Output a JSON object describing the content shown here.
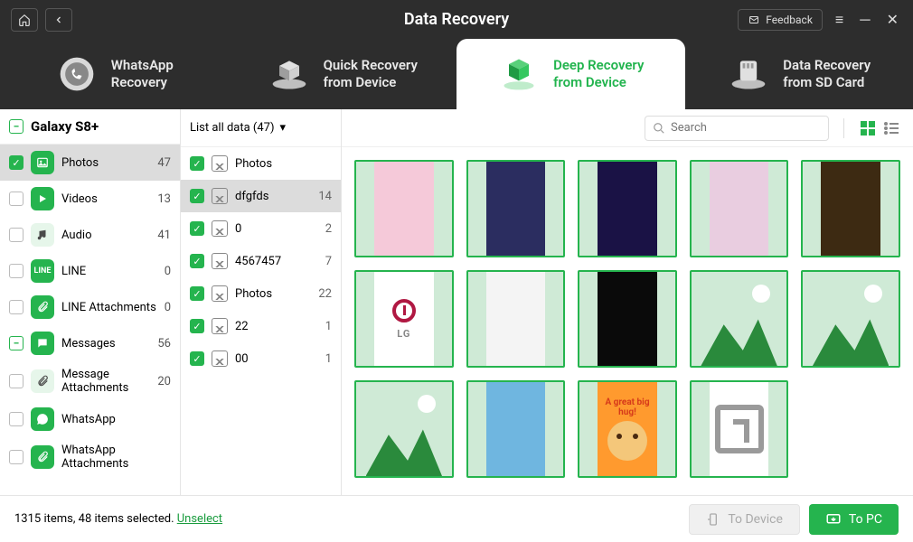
{
  "window": {
    "title": "Data Recovery",
    "feedback_label": "Feedback"
  },
  "tabs": [
    {
      "line1": "WhatsApp",
      "line2": "Recovery"
    },
    {
      "line1": "Quick Recovery",
      "line2": "from Device"
    },
    {
      "line1": "Deep Recovery",
      "line2": "from Device"
    },
    {
      "line1": "Data Recovery",
      "line2": "from SD Card"
    }
  ],
  "device": {
    "name": "Galaxy S8+"
  },
  "categories": [
    {
      "label": "Photos",
      "count": 47,
      "checked": true,
      "selected": true,
      "color": "#25b44e",
      "icon": "image"
    },
    {
      "label": "Videos",
      "count": 13,
      "checked": false,
      "color": "#25b44e",
      "icon": "play"
    },
    {
      "label": "Audio",
      "count": 41,
      "checked": false,
      "color": "#e6f6ea",
      "icon": "music",
      "fg": "#4a4a4a"
    },
    {
      "label": "LINE",
      "count": 0,
      "checked": false,
      "color": "#25b44e",
      "icon": "line"
    },
    {
      "label": "LINE Attachments",
      "count": 0,
      "checked": false,
      "color": "#25b44e",
      "icon": "attach"
    },
    {
      "label": "Messages",
      "count": 56,
      "checked": false,
      "expander": "minus",
      "color": "#25b44e",
      "icon": "sms"
    },
    {
      "label": "Message Attachments",
      "count": 20,
      "checked": false,
      "color": "#e6f6ea",
      "icon": "attach",
      "fg": "#4a4a4a"
    },
    {
      "label": "WhatsApp",
      "count": "",
      "checked": false,
      "color": "#25b44e",
      "icon": "whatsapp"
    },
    {
      "label": "WhatsApp Attachments",
      "count": "",
      "checked": false,
      "color": "#25b44e",
      "icon": "attach"
    }
  ],
  "filter": {
    "label": "List all data (47)"
  },
  "folders": [
    {
      "name": "Photos",
      "count": "",
      "checked": true
    },
    {
      "name": "dfgfds",
      "count": 14,
      "checked": true,
      "selected": true
    },
    {
      "name": "0",
      "count": 2,
      "checked": true
    },
    {
      "name": "4567457",
      "count": 7,
      "checked": true
    },
    {
      "name": "Photos",
      "count": 22,
      "checked": true
    },
    {
      "name": "22",
      "count": 1,
      "checked": true
    },
    {
      "name": "00",
      "count": 1,
      "checked": true
    }
  ],
  "thumbnails": [
    {
      "kind": "img",
      "bg": "#f5c9d9"
    },
    {
      "kind": "img",
      "bg": "#2b2d60"
    },
    {
      "kind": "img",
      "bg": "#1a1245"
    },
    {
      "kind": "img",
      "bg": "#e9cde0"
    },
    {
      "kind": "img",
      "bg": "#3d2a12"
    },
    {
      "kind": "lg"
    },
    {
      "kind": "img",
      "bg": "#f4f4f4"
    },
    {
      "kind": "img",
      "bg": "#0a0a0a"
    },
    {
      "kind": "placeholder"
    },
    {
      "kind": "placeholder"
    },
    {
      "kind": "placeholder"
    },
    {
      "kind": "img",
      "bg": "#6fb6e0"
    },
    {
      "kind": "hug",
      "text": "A great big hug!"
    },
    {
      "kind": "glyph"
    }
  ],
  "search": {
    "placeholder": "Search"
  },
  "footer": {
    "status_prefix": "1315 items, 48 items selected.",
    "unselect_label": "Unselect",
    "to_device_label": "To Device",
    "to_pc_label": "To PC"
  }
}
